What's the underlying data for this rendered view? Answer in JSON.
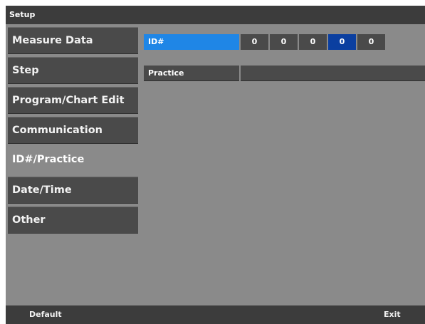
{
  "window": {
    "title": "Setup"
  },
  "sidebar": {
    "items": [
      {
        "label": "Measure Data",
        "active": false
      },
      {
        "label": "Step",
        "active": false
      },
      {
        "label": "Program/Chart Edit",
        "active": false
      },
      {
        "label": "Communication",
        "active": false
      },
      {
        "label": "ID#/Practice",
        "active": true
      },
      {
        "label": "Date/Time",
        "active": false
      },
      {
        "label": "Other",
        "active": false
      }
    ]
  },
  "settings": {
    "id": {
      "label": "ID#",
      "digits": [
        "0",
        "0",
        "0",
        "0",
        "0"
      ],
      "selected_digit_index": 3
    },
    "practice": {
      "label": "Practice",
      "value": ""
    }
  },
  "footer": {
    "default_label": "Default",
    "exit_label": "Exit"
  },
  "colors": {
    "accent": "#1f86e6",
    "selected_digit": "#0b3fa0",
    "panel": "#4a4a4a",
    "background": "#8a8a8a",
    "bar": "#3c3c3c"
  }
}
